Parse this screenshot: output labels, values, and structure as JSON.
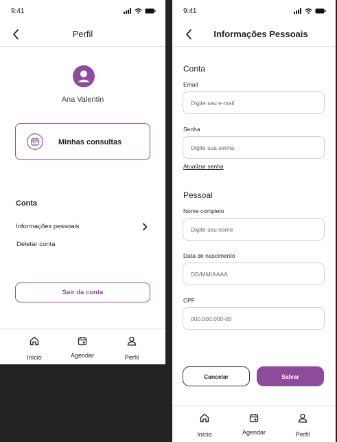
{
  "colors": {
    "accent": "#8e4a9b",
    "background": "#222222",
    "screen": "#ffffff"
  },
  "perfil_screen": {
    "status_time": "9:41",
    "title": "Perfil",
    "user_name": "Ana Valentin",
    "consultas_label": "Minhas consultas",
    "section_conta": "Conta",
    "menu": {
      "info": "Informações pessoais",
      "delete": "Deletar conta"
    },
    "logout_label": "Sair da conta",
    "tabs": {
      "inicio": "Início",
      "agendar": "Agendar",
      "perfil": "Perfil"
    }
  },
  "info_screen": {
    "status_time": "9:41",
    "title": "Informações Pessoais",
    "section_conta": "Conta",
    "email": {
      "label": "Email",
      "placeholder": "Digite seu e-mail"
    },
    "senha": {
      "label": "Senha",
      "placeholder": "Digite sua senha"
    },
    "update_password_link": "Atualizar senha",
    "section_pessoal": "Pessoal",
    "nome": {
      "label": "Nome completo",
      "placeholder": "Digite seu nome"
    },
    "nascimento": {
      "label": "Data de nascimento",
      "placeholder": "DD/MM/AAAA"
    },
    "cpf": {
      "label": "CPF",
      "placeholder": "000.000.000-00"
    },
    "cancel_label": "Cancelar",
    "save_label": "Salvar",
    "tabs": {
      "inicio": "Início",
      "agendar": "Agendar",
      "perfil": "Perfil"
    }
  },
  "icons": {
    "back": "chevron-left-icon",
    "avatar": "user-circle-icon",
    "consultas": "calendar-icon",
    "menu_info": "chevron-right-icon",
    "tab_inicio": "home-icon",
    "tab_agendar": "calendar-plus-icon",
    "tab_perfil": "user-icon"
  }
}
